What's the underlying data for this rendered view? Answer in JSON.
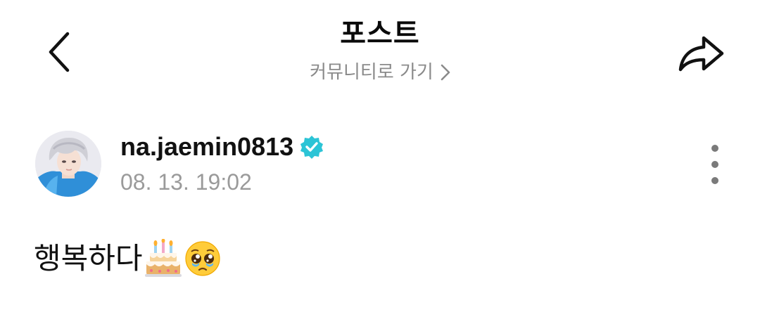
{
  "header": {
    "title": "포스트",
    "community_link": "커뮤니티로 가기",
    "back_icon": "chevron-left-icon",
    "share_icon": "share-arrow-icon",
    "community_chevron_icon": "chevron-right-icon"
  },
  "post": {
    "author": "na.jaemin0813",
    "verified": true,
    "verified_color": "#2cc4d6",
    "timestamp": "08. 13. 19:02",
    "text": "행복하다",
    "emojis": [
      "birthday-cake-icon",
      "pleading-face-icon"
    ],
    "more_icon": "more-vertical-icon"
  }
}
